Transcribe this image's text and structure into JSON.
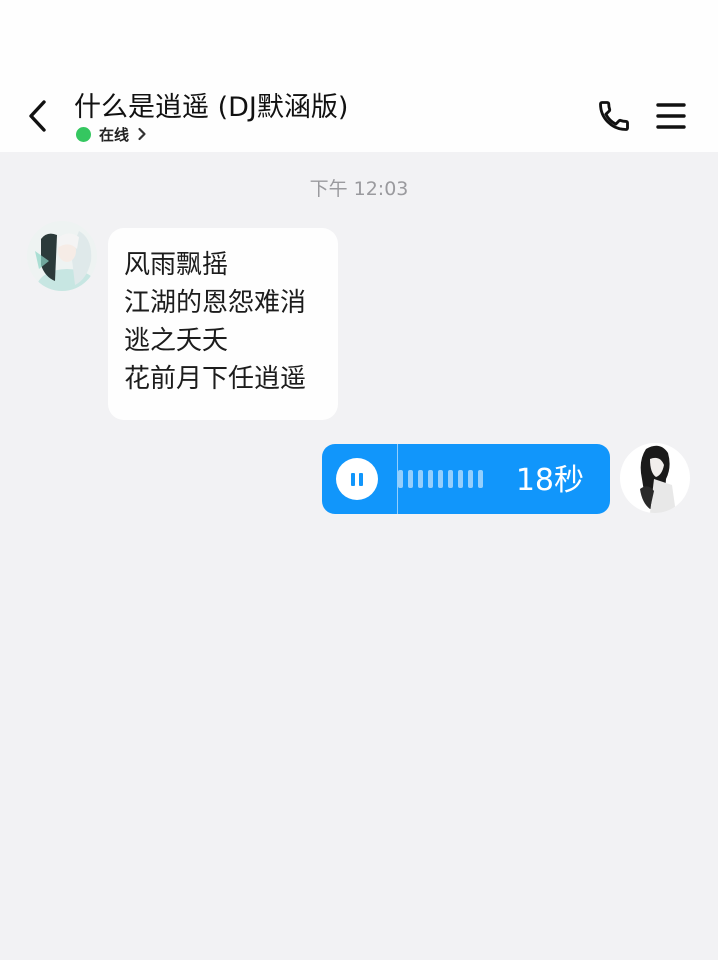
{
  "header": {
    "title": "什么是逍遥 (DJ默涵版)",
    "status": "在线",
    "status_color": "#35c760"
  },
  "icons": {
    "back": "chevron-left-icon",
    "status_arrow": "chevron-right-icon",
    "call": "phone-icon",
    "menu": "hamburger-menu-icon"
  },
  "chat": {
    "timestamp": "下午 12:03",
    "incoming": {
      "lines": [
        "风雨飘摇",
        "江湖的恩怨难消",
        "逃之夭夭",
        "花前月下任逍遥"
      ]
    },
    "outgoing_voice": {
      "duration": "18秒",
      "state": "playing",
      "color": "#1196fb"
    }
  }
}
